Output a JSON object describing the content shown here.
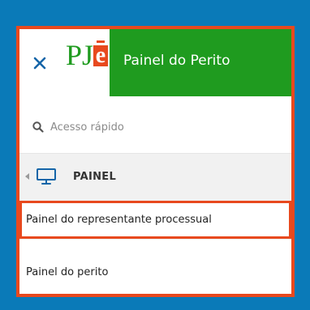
{
  "header": {
    "close_icon": "close-icon",
    "logo_text": "PJ",
    "logo_badge": "e",
    "title": "Painel do Perito",
    "colors": {
      "header_bg": "#1f9b1f",
      "accent": "#e8491e",
      "page_bg": "#0a7ab8"
    }
  },
  "search": {
    "icon": "search-icon",
    "placeholder": "Acesso rápido"
  },
  "nav": {
    "section": {
      "icon": "monitor-icon",
      "label": "PAINEL"
    },
    "items": [
      {
        "label": "Painel do representante processual",
        "highlighted": true
      },
      {
        "label": "Painel do perito",
        "highlighted": false
      }
    ]
  }
}
